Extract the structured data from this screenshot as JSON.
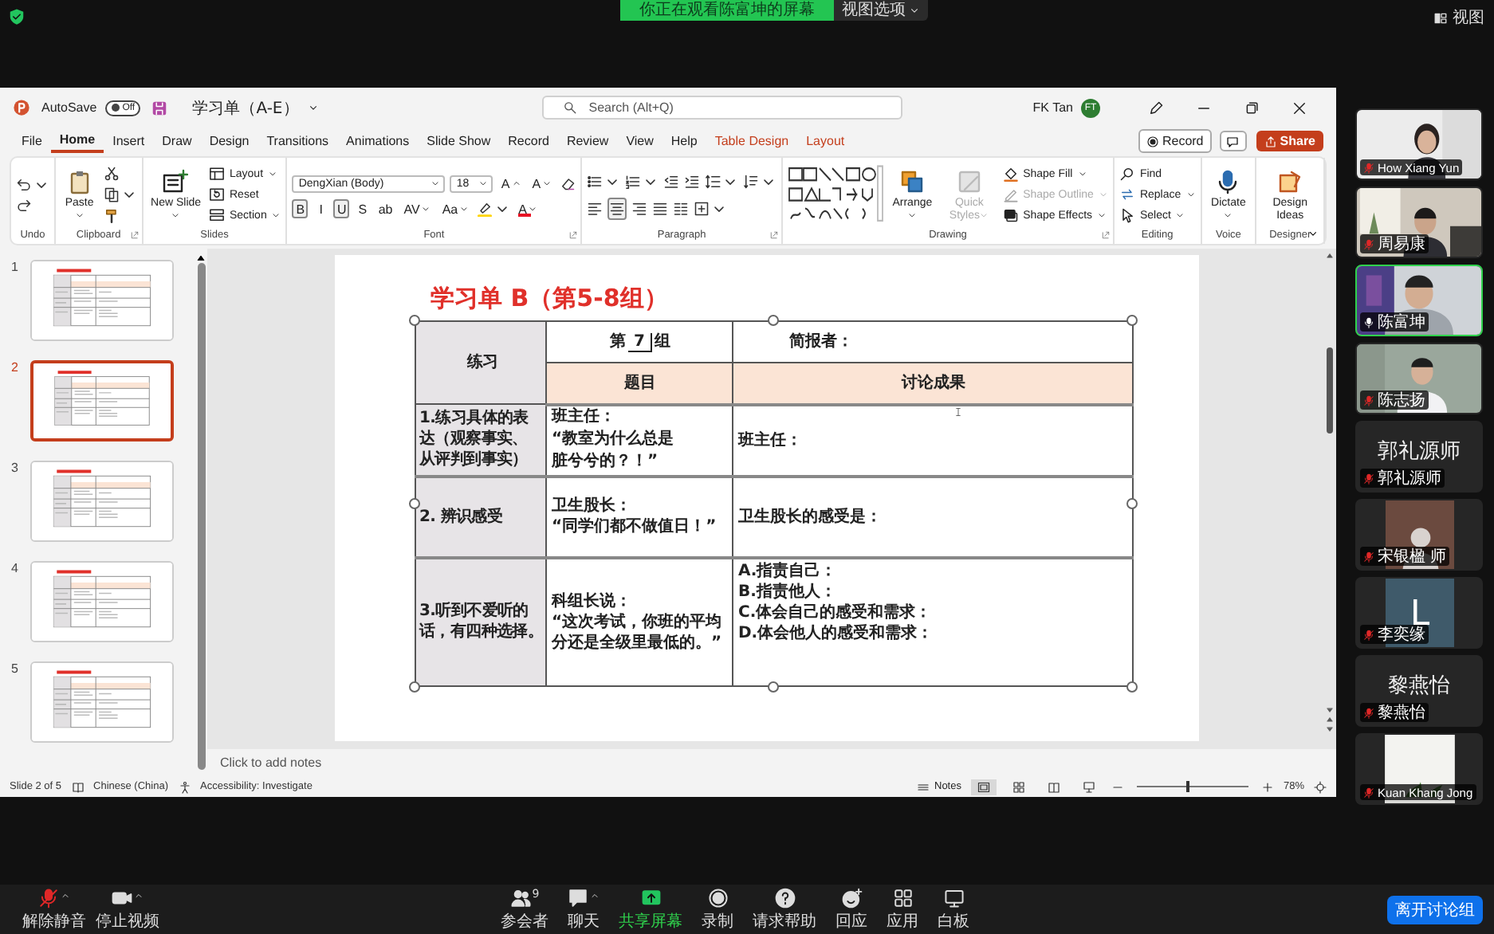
{
  "meeting": {
    "banner": "你正在观看陈富坤的屏幕",
    "view_options": "视图选项",
    "view": "视图"
  },
  "window": {
    "autosave": {
      "label": "AutoSave",
      "on": false,
      "state_label": "Off"
    },
    "file_name": "学习单（A-E）",
    "search_placeholder": "Search (Alt+Q)",
    "user_name": "FK Tan",
    "user_initials": "FT"
  },
  "menu_tabs": [
    {
      "label": "File",
      "selected": false,
      "contextual": false
    },
    {
      "label": "Home",
      "selected": true,
      "contextual": false
    },
    {
      "label": "Insert",
      "selected": false,
      "contextual": false
    },
    {
      "label": "Draw",
      "selected": false,
      "contextual": false
    },
    {
      "label": "Design",
      "selected": false,
      "contextual": false
    },
    {
      "label": "Transitions",
      "selected": false,
      "contextual": false
    },
    {
      "label": "Animations",
      "selected": false,
      "contextual": false
    },
    {
      "label": "Slide Show",
      "selected": false,
      "contextual": false
    },
    {
      "label": "Record",
      "selected": false,
      "contextual": false
    },
    {
      "label": "Review",
      "selected": false,
      "contextual": false
    },
    {
      "label": "View",
      "selected": false,
      "contextual": false
    },
    {
      "label": "Help",
      "selected": false,
      "contextual": false
    },
    {
      "label": "Table Design",
      "selected": false,
      "contextual": true
    },
    {
      "label": "Layout",
      "selected": false,
      "contextual": true
    }
  ],
  "record_button": "Record",
  "share_button": "Share",
  "ribbon": [
    {
      "label": "Undo",
      "launcher": false,
      "stacks": [
        {
          "tools": [
            {
              "kind": "icon",
              "menu": true
            },
            {
              "kind": "icon",
              "menu": false
            }
          ]
        }
      ]
    },
    {
      "label": "Clipboard",
      "launcher": true,
      "stacks": [
        {
          "tools": [
            {
              "kind": "large",
              "label": "Paste",
              "menu": true,
              "disabled": false
            }
          ]
        },
        {
          "tools": [
            {
              "kind": "icon",
              "menu": false
            },
            {
              "kind": "icon",
              "menu": true
            },
            {
              "kind": "icon",
              "menu": false
            }
          ]
        }
      ]
    },
    {
      "label": "Slides",
      "launcher": false,
      "stacks": [
        {
          "tools": [
            {
              "kind": "large",
              "label": "New Slide",
              "menu": true,
              "disabled": false
            }
          ]
        },
        {
          "tools": [
            {
              "kind": "small",
              "label": "Layout",
              "menu": true,
              "disabled": false
            },
            {
              "kind": "small",
              "label": "Reset",
              "menu": false,
              "disabled": false
            },
            {
              "kind": "small",
              "label": "Section",
              "menu": true,
              "disabled": false
            }
          ]
        }
      ]
    },
    {
      "label": "Font",
      "launcher": true,
      "lines": [
        {
          "tools": [
            {
              "kind": "field",
              "value": "DengXian (Body)",
              "wide": true,
              "menu": true
            },
            {
              "kind": "field",
              "value": "18",
              "wide": false,
              "menu": true
            },
            {
              "kind": "glyph",
              "label": "A",
              "increase": true,
              "menu": false,
              "selected": false
            },
            {
              "kind": "glyph",
              "label": "A",
              "increase": false,
              "menu": false,
              "selected": false
            },
            {
              "kind": "icon",
              "menu": false
            }
          ]
        },
        {
          "tools": [
            {
              "kind": "glyph",
              "label": "B",
              "menu": false,
              "selected": true
            },
            {
              "kind": "glyph",
              "label": "I",
              "menu": false,
              "selected": false
            },
            {
              "kind": "glyph",
              "label": "U",
              "menu": false,
              "selected": true
            },
            {
              "kind": "glyph",
              "label": "S",
              "menu": false,
              "selected": false
            },
            {
              "kind": "glyph",
              "label": "ab",
              "menu": false,
              "selected": false
            },
            {
              "kind": "glyph",
              "label": "AV",
              "menu": true,
              "selected": false
            },
            {
              "kind": "glyph",
              "label": "Aa",
              "menu": true,
              "selected": false
            },
            {
              "kind": "icon",
              "menu": true
            },
            {
              "kind": "glyph",
              "label": "A",
              "color": "#e81123",
              "menu": true,
              "selected": false
            }
          ]
        }
      ]
    },
    {
      "label": "Paragraph",
      "launcher": true,
      "lines": [
        {
          "tools": [
            {
              "kind": "icon",
              "menu": true
            },
            {
              "kind": "icon",
              "menu": true
            },
            {
              "kind": "icon",
              "menu": false
            },
            {
              "kind": "icon",
              "menu": false
            },
            {
              "kind": "icon",
              "menu": true
            },
            {
              "kind": "icon",
              "menu": true
            }
          ]
        },
        {
          "tools": [
            {
              "kind": "icon",
              "menu": false,
              "selected": false
            },
            {
              "kind": "icon",
              "menu": false,
              "selected": true
            },
            {
              "kind": "icon",
              "menu": false,
              "selected": false
            },
            {
              "kind": "icon",
              "menu": false,
              "selected": false
            },
            {
              "kind": "icon",
              "menu": false,
              "selected": false
            },
            {
              "kind": "icon",
              "menu": true,
              "selected": false
            }
          ]
        }
      ]
    },
    {
      "label": "Drawing",
      "launcher": true,
      "stacks": [
        {
          "tools": [
            {
              "kind": "gallery"
            }
          ]
        },
        {
          "tools": [
            {
              "kind": "large",
              "label": "Arrange",
              "menu": true,
              "disabled": false
            }
          ]
        },
        {
          "tools": [
            {
              "kind": "large",
              "label": "Quick Styles",
              "menu": true,
              "disabled": true
            }
          ]
        },
        {
          "tools": [
            {
              "kind": "small",
              "label": "Shape Fill",
              "menu": true,
              "disabled": false
            },
            {
              "kind": "small",
              "label": "Shape Outline",
              "menu": true,
              "disabled": true
            },
            {
              "kind": "small",
              "label": "Shape Effects",
              "menu": true,
              "disabled": false
            }
          ]
        }
      ]
    },
    {
      "label": "Editing",
      "launcher": false,
      "stacks": [
        {
          "tools": [
            {
              "kind": "small",
              "label": "Find",
              "menu": false,
              "disabled": false
            },
            {
              "kind": "small",
              "label": "Replace",
              "menu": true,
              "disabled": false
            },
            {
              "kind": "small",
              "label": "Select",
              "menu": true,
              "disabled": false
            }
          ]
        }
      ]
    },
    {
      "label": "Voice",
      "launcher": false,
      "stacks": [
        {
          "tools": [
            {
              "kind": "large",
              "label": "Dictate",
              "menu": true,
              "disabled": false
            }
          ]
        }
      ]
    },
    {
      "label": "Designer",
      "launcher": false,
      "stacks": [
        {
          "tools": [
            {
              "kind": "large",
              "label": "Design Ideas",
              "menu": false,
              "disabled": false
            }
          ]
        }
      ]
    }
  ],
  "slides": [
    {
      "number": "1",
      "selected": false
    },
    {
      "number": "2",
      "selected": true
    },
    {
      "number": "3",
      "selected": false
    },
    {
      "number": "4",
      "selected": false
    },
    {
      "number": "5",
      "selected": false
    }
  ],
  "slide": {
    "title": "学习单 B（第5-8组）",
    "table": {
      "corner": "练习",
      "group_prefix": "第",
      "group_number": "7",
      "group_suffix": "组",
      "reporter": "简报者：",
      "columns": [
        "题目",
        "讨论成果"
      ],
      "rows": [
        {
          "task": [
            "1.练习具体的表",
            "达（观察事实、",
            "从评判到事实）"
          ],
          "prompt": [
            "班主任：",
            "“教室为什么总是",
            "脏兮兮的？！”"
          ],
          "result": [
            "班主任："
          ]
        },
        {
          "task": [
            "2. 辨识感受"
          ],
          "prompt": [
            "卫生股长：",
            "“同学们都不做值日！”"
          ],
          "result": [
            "卫生股长的感受是："
          ]
        },
        {
          "task": [
            "3.听到不爱听的",
            "话，有四种选择。"
          ],
          "prompt": [
            "科组长说：",
            "“这次考试，你班的平均",
            "分还是全级里最低的。”"
          ],
          "result": [
            "A.指责自己：",
            "B.指责他人：",
            "C.体会自己的感受和需求：",
            "D.体会他人的感受和需求："
          ]
        }
      ]
    }
  },
  "notes_placeholder": "Click to add notes",
  "status_bar": {
    "slide_info": "Slide 2 of 5",
    "language": "Chinese (China)",
    "accessibility": "Accessibility: Investigate",
    "notes": "Notes",
    "views": [
      {
        "selected": true
      },
      {
        "selected": false
      },
      {
        "selected": false
      },
      {
        "selected": false
      }
    ],
    "zoom": {
      "label": "78%",
      "level": 0.45
    }
  },
  "participants": [
    {
      "name": "How Xiang Yun",
      "kind": "video",
      "muted": true,
      "speaking": false
    },
    {
      "name": "周易康",
      "kind": "video",
      "muted": true,
      "speaking": false
    },
    {
      "name": "陈富坤",
      "kind": "video",
      "muted": false,
      "speaking": true
    },
    {
      "name": "陈志扬",
      "kind": "video",
      "muted": true,
      "speaking": false
    },
    {
      "name": "郭礼源师",
      "kind": "name",
      "display_name": "郭礼源师",
      "muted": true,
      "speaking": false
    },
    {
      "name": "宋银楹 师",
      "kind": "avatar",
      "muted": true,
      "speaking": false
    },
    {
      "name": "李奕缘",
      "kind": "letter",
      "initial": "L",
      "muted": true,
      "speaking": false
    },
    {
      "name": "黎燕怡",
      "kind": "name",
      "display_name": "黎燕怡",
      "muted": true,
      "speaking": false
    },
    {
      "name": "Kuan Khang Jong",
      "kind": "video",
      "muted": true,
      "speaking": false
    }
  ],
  "toolbar": {
    "left_items": [
      {
        "label": "解除静音",
        "menu": true,
        "active": false
      },
      {
        "label": "停止视频",
        "menu": true,
        "active": false
      }
    ],
    "center_items": [
      {
        "label": "参会者",
        "count": "9",
        "menu": false,
        "active": false
      },
      {
        "label": "聊天",
        "menu": true,
        "active": false
      },
      {
        "label": "共享屏幕",
        "menu": false,
        "active": true
      },
      {
        "label": "录制",
        "menu": false,
        "active": false
      },
      {
        "label": "请求帮助",
        "menu": false,
        "active": false
      },
      {
        "label": "回应",
        "menu": false,
        "active": false
      },
      {
        "label": "应用",
        "menu": false,
        "active": false
      },
      {
        "label": "白板",
        "menu": false,
        "active": false
      }
    ],
    "leave_button": "离开讨论组"
  }
}
